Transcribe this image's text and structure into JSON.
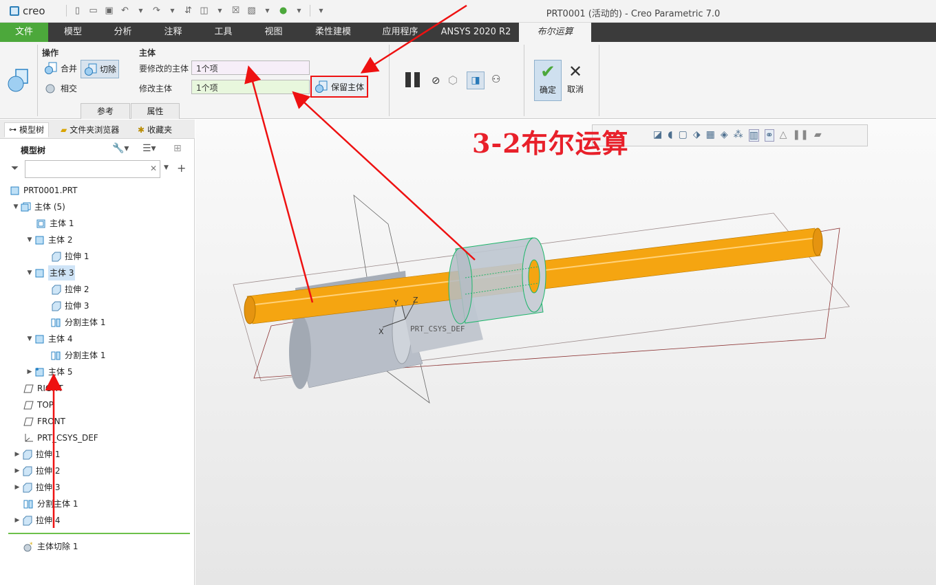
{
  "titlebar": {
    "logo": "creo",
    "window_title": "PRT0001 (活动的) - Creo Parametric 7.0"
  },
  "tabs": [
    "文件",
    "模型",
    "分析",
    "注释",
    "工具",
    "视图",
    "柔性建模",
    "应用程序",
    "ANSYS 2020 R2",
    "布尔运算"
  ],
  "ribbon": {
    "operation_group": "操作",
    "merge": "合并",
    "cut": "切除",
    "intersect": "相交",
    "body_group": "主体",
    "modify_label": "要修改的主体",
    "modify_value": "1个项",
    "modifier_label": "修改主体",
    "modifier_value": "1个项",
    "keep_body": "保留主体",
    "subtab_ref": "参考",
    "subtab_props": "属性",
    "ok": "确定",
    "cancel": "取消"
  },
  "panel": {
    "tabs": [
      "模型树",
      "文件夹浏览器",
      "收藏夹"
    ],
    "tree_title": "模型树",
    "items": [
      "PRT0001.PRT",
      "主体 (5)",
      "主体 1",
      "主体 2",
      "拉伸 1",
      "主体 3",
      "拉伸 2",
      "拉伸 3",
      "分割主体 1",
      "主体 4",
      "分割主体 1",
      "主体 5",
      "RIGHT",
      "TOP",
      "FRONT",
      "PRT_CSYS_DEF",
      "拉伸 1",
      "拉伸 2",
      "拉伸 3",
      "分割主体 1",
      "拉伸 4",
      "主体切除 1"
    ]
  },
  "graphics": {
    "heading": "3-2布尔运算",
    "csys_label": "PRT_CSYS_DEF",
    "axis_x": "X",
    "axis_y": "Y",
    "axis_z": "Z"
  },
  "colors": {
    "accent_green": "#4ca83b",
    "highlight_red": "#e11",
    "rod_orange": "#f5a511"
  }
}
